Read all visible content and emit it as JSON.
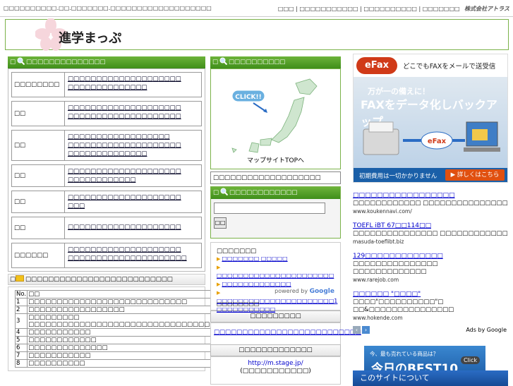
{
  "topbar": {
    "left_text": "□□□□□□□□□□.□□.□□□□□□□.□□□□□□□□□□□□□□□□□□□",
    "links": [
      "□□□",
      "□□□□□□□□□□□",
      "□□□□□□□□□□",
      "□□□□□□□"
    ],
    "company": "株式会社アトラス"
  },
  "header": {
    "title": "進学まっぷ"
  },
  "category_panel": {
    "heading": "□□□□□□□□□□□□□□",
    "rows": [
      {
        "name": "□□□□□□□□",
        "links": [
          "□□□□□□□□□□□□□□□□□□□□",
          "□□□□□□□□□□□□□□"
        ]
      },
      {
        "name": "□□",
        "links": [
          "□□□□□□□□□□□□□□□□□□□□",
          "□□□□□□□□□□□□□□□□□□□□"
        ]
      },
      {
        "name": "□□",
        "links": [
          "□□□□□□□□□□□□□□□□□□",
          "□□□□□□□□□□□□□□□□□□□□",
          "□□□□□□□□□□□□□□"
        ]
      },
      {
        "name": "□□",
        "links": [
          "□□□□□□□□□□□□□□□□□□□□",
          "□□□□□□□□□□□□"
        ]
      },
      {
        "name": "□□",
        "links": [
          "□□□□□□□□□□□□□□□□□□□□",
          "□□□"
        ]
      },
      {
        "name": "□□",
        "links": [
          "□□□□□□□□□□□□□□□□□□□□"
        ]
      },
      {
        "name": "□□□□□□",
        "links": [
          "□□□□□□□□□□□□□□□□□□□□",
          "□□□□□□□□□□□□□□□□□□□□□"
        ]
      }
    ]
  },
  "ranking": {
    "heading": "□□□□□□□□□□□□□□□□□□□□□□□□□□",
    "columns": [
      "No.",
      "□□",
      "□□□"
    ],
    "rows": [
      [
        "1",
        "□□□□□□□□□□□□□□□□□□□□□□□□□□□□",
        "□□□"
      ],
      [
        "2",
        "□□□□□□□□□□□□□□□□□",
        "□□□"
      ],
      [
        "3",
        "□□□□□□□□□ □□□□□□□□□□□□□□□□□□□□□□□□□□□□□□□□□",
        "□□□"
      ],
      [
        "4",
        "□□□□□□□□□□□",
        "□□□"
      ],
      [
        "5",
        "□□□□□□□□□□□□",
        "□□□"
      ],
      [
        "6",
        "□□□□□□□□□□□□□□",
        "□□□□"
      ],
      [
        "7",
        "□□□□□□□□□□□",
        "□□□"
      ],
      [
        "8",
        "□□□□□□□□□□",
        "□□□"
      ]
    ]
  },
  "map_panel": {
    "heading": "□□□□□□□□□□",
    "click_label": "CLICK!!",
    "caption": "マップサイトTOPへ",
    "search_text": "□□□□□□□□□□□□□□□□□□□"
  },
  "search_panel": {
    "heading": "□□□□□□□□□□□□",
    "button": "□□"
  },
  "google_box": {
    "title": "□□□□□□□",
    "links": [
      "□□□□□□□ □□□□□",
      "□□□□□□□□□□□□□□□□□□□□□□",
      "□□□□□□□□□□□□□",
      "□□□□□□□□□□□□□□□□□□□□□□1 □□□□□□□□□□□"
    ],
    "powered_by": "powered by",
    "powered_brand": "Google",
    "footer": "□□□□□□□□"
  },
  "box_a": {
    "heading": "□□□□□□□□□",
    "link": "□□□□□□□□□□□□□□□□□□□□□□□□□□"
  },
  "box_b": {
    "heading": "□□□□□□□□□□□□□",
    "url": "http://m.stage.jp/",
    "note": "(□□□□□□□□□□□)"
  },
  "efax": {
    "logo": "eFax",
    "tagline": "どこでもFAXをメールで送受信",
    "line1": "万が一の備えに！",
    "line2": "FAXをデータ化しバックアップ",
    "bottom": "初期費用は一切かかりません",
    "button": "▶ 詳しくはこちら"
  },
  "ads": [
    {
      "title": "□□□□□□□□□□□□□□□□□",
      "desc": "□□□□□□□□□□□□ □□□□□□□□□□□□□□□",
      "url": "www.koukennavi.com/"
    },
    {
      "title": "TOEFL iBT 67□□114□□",
      "desc": "□□□□□□□□□□□□□□□ □□□□□□□□□□□□",
      "url": "masuda-toeflibt.biz"
    },
    {
      "title": "129□□□□□□□□□□□□□",
      "desc": "□□□□□□□□□□□□□□□ □□□□□□□□□□□□□",
      "url": "www.rarejob.com"
    },
    {
      "title": "□□□□□□ \"□□□□\"",
      "desc": "□□□□\"□□□□□□□□□□\"□ □□&□□□□□□□□□□□□□□□",
      "url": "www.hokende.com"
    }
  ],
  "ads_by": "Ads by Google",
  "best_banner": {
    "line1": "今、最も売れている商品は？",
    "line2": "今日のBEST10",
    "click": "Click"
  },
  "about": "このサイトについて"
}
